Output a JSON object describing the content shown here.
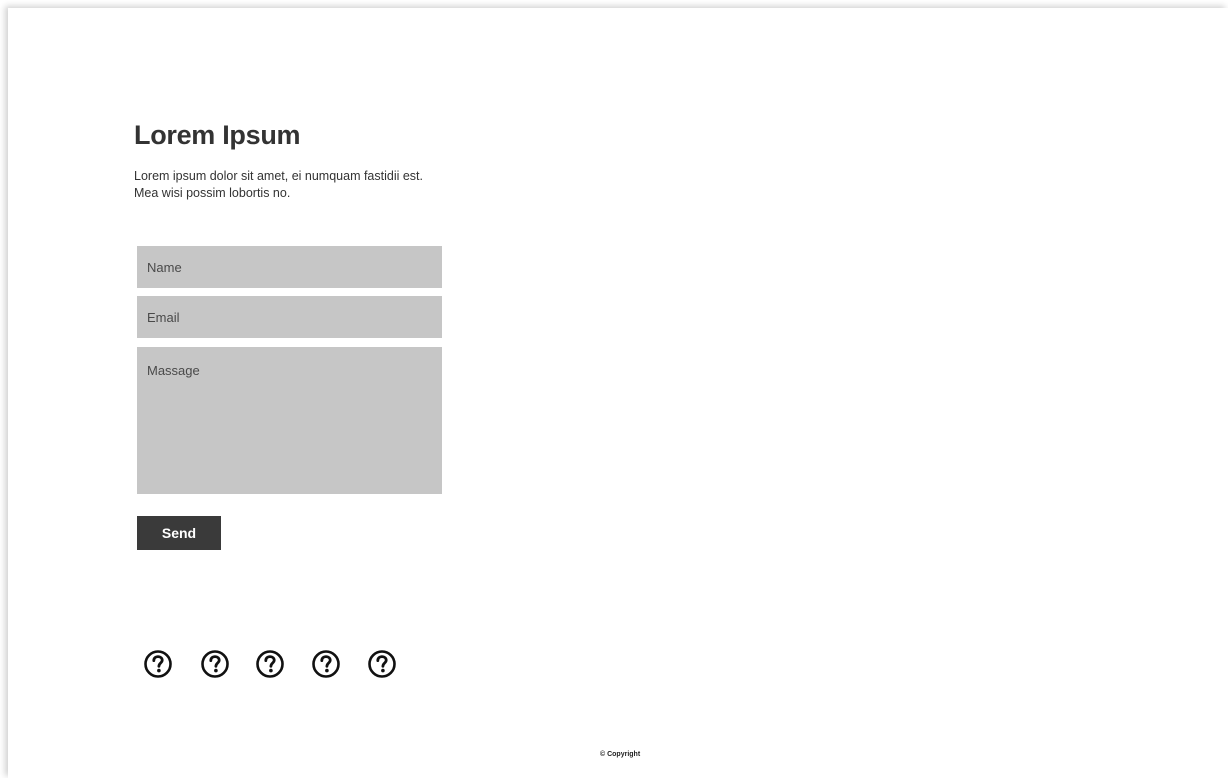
{
  "header": {
    "title": "Lorem Ipsum",
    "description": "Lorem ipsum dolor sit amet, ei numquam fastidii est. Mea wisi possim lobortis no."
  },
  "form": {
    "name_placeholder": "Name",
    "email_placeholder": "Email",
    "message_placeholder": "Massage",
    "send_label": "Send"
  },
  "social": {
    "icons": [
      "help-circle-icon",
      "help-circle-icon",
      "help-circle-icon",
      "help-circle-icon",
      "help-circle-icon"
    ]
  },
  "footer": {
    "copyright": "© Copyright"
  },
  "colors": {
    "field_background": "#c6c6c6",
    "button_background": "#3a3a3a",
    "text": "#333333"
  }
}
